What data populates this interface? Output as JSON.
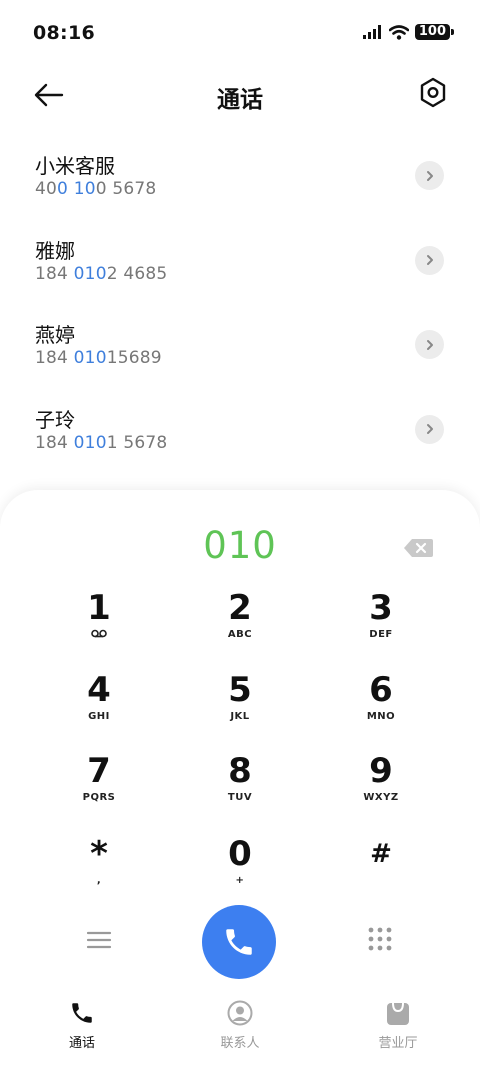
{
  "status": {
    "time": "08:16",
    "battery": "100"
  },
  "header": {
    "title": "通话"
  },
  "results": [
    {
      "name": "小米客服",
      "num_pre": "40",
      "num_hl1": "0",
      "num_mid": " ",
      "num_hl2": "10",
      "num_post": "0 5678"
    },
    {
      "name": "雅娜",
      "num_pre": "184 ",
      "num_hl1": "010",
      "num_mid": "",
      "num_hl2": "",
      "num_post": "2 4685"
    },
    {
      "name": "燕婷",
      "num_pre": "184 ",
      "num_hl1": "010",
      "num_mid": "",
      "num_hl2": "",
      "num_post": "15689"
    },
    {
      "name": "子玲",
      "num_pre": "184 ",
      "num_hl1": "010",
      "num_mid": "",
      "num_hl2": "",
      "num_post": "1 5678"
    }
  ],
  "dialpad": {
    "entered": "010",
    "keys": [
      {
        "digit": "1",
        "letters": "voicemail"
      },
      {
        "digit": "2",
        "letters": "ABC"
      },
      {
        "digit": "3",
        "letters": "DEF"
      },
      {
        "digit": "4",
        "letters": "GHI"
      },
      {
        "digit": "5",
        "letters": "JKL"
      },
      {
        "digit": "6",
        "letters": "MNO"
      },
      {
        "digit": "7",
        "letters": "PQRS"
      },
      {
        "digit": "8",
        "letters": "TUV"
      },
      {
        "digit": "9",
        "letters": "WXYZ"
      },
      {
        "digit": "*",
        "letters": ","
      },
      {
        "digit": "0",
        "letters": "+"
      },
      {
        "digit": "#",
        "letters": ""
      }
    ]
  },
  "tabs": [
    {
      "label": "通话",
      "icon": "phone-icon",
      "active": true
    },
    {
      "label": "联系人",
      "icon": "contact-icon",
      "active": false
    },
    {
      "label": "营业厅",
      "icon": "shopping-bag-icon",
      "active": false
    }
  ],
  "colors": {
    "accent": "#3d7ff0",
    "highlight": "#3f7fdc",
    "entered": "#5fc456"
  }
}
